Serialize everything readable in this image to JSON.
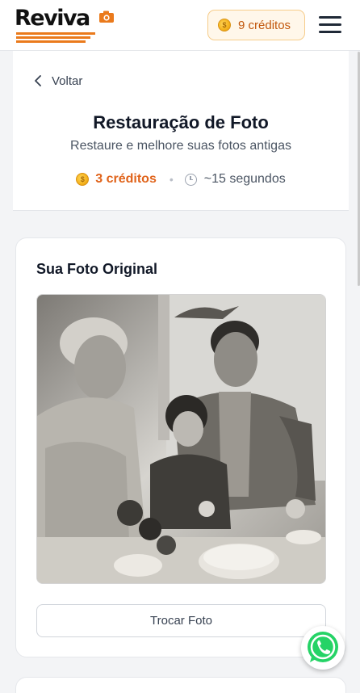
{
  "header": {
    "logo_text": "Reviva",
    "credits_label": "9 créditos"
  },
  "page": {
    "back_label": "Voltar",
    "title": "Restauração de Foto",
    "subtitle": "Restaure e melhore suas fotos antigas",
    "cost_label": "3 créditos",
    "separator": "•",
    "time_label": "~15 segundos"
  },
  "photo_section": {
    "title": "Sua Foto Original",
    "swap_button_label": "Trocar Foto"
  },
  "icons": {
    "coin": "coin-icon",
    "clock": "clock-icon",
    "back": "chevron-left-icon",
    "menu": "hamburger-menu-icon",
    "whatsapp": "whatsapp-icon",
    "camera": "camera-icon"
  },
  "colors": {
    "accent": "#e0631a",
    "credit_pill_bg": "#fff7ea",
    "credit_pill_border": "#f6cc8a",
    "logo_stripe": "#ea7a1c",
    "whatsapp_green": "#25d366"
  }
}
